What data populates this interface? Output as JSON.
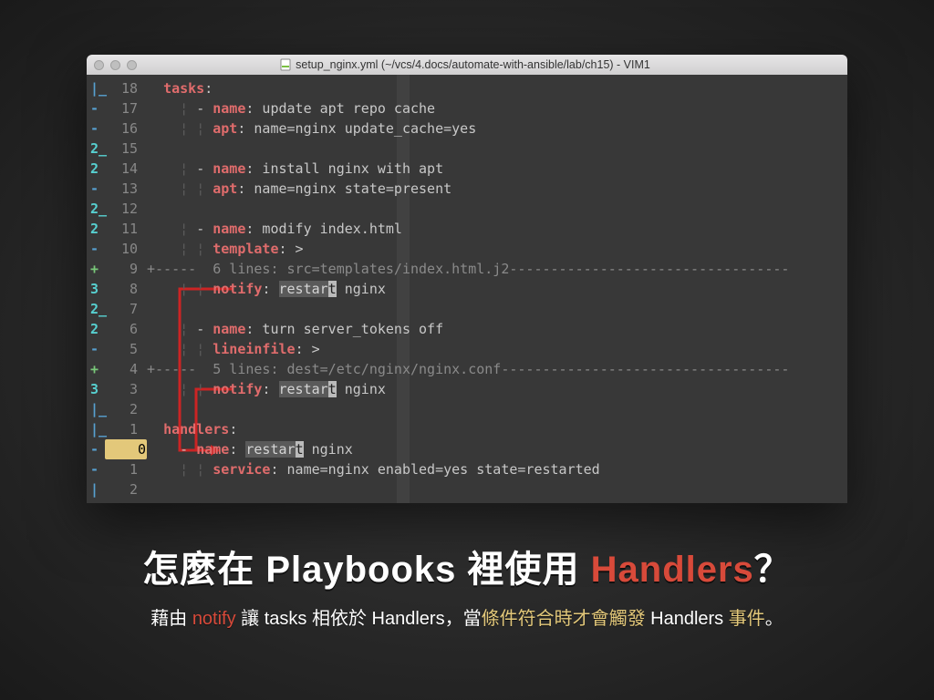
{
  "window_title": "setup_nginx.yml (~/vcs/4.docs/automate-with-ansible/lab/ch15) - VIM1",
  "lines": [
    {
      "sign": "|_",
      "signcls": "s-blue",
      "num": "18",
      "spans": [
        {
          "t": "  ",
          "c": "grey"
        },
        {
          "t": "tasks",
          "c": "kw"
        },
        {
          "t": ":",
          "c": "grey"
        }
      ]
    },
    {
      "sign": "-",
      "signcls": "s-blue",
      "num": "17",
      "spans": [
        {
          "t": "    ",
          "c": "grey"
        },
        {
          "t": "¦ ",
          "c": "guide"
        },
        {
          "t": "- ",
          "c": "grey"
        },
        {
          "t": "name",
          "c": "kw"
        },
        {
          "t": ": update apt repo cache",
          "c": "grey"
        }
      ]
    },
    {
      "sign": "-",
      "signcls": "s-blue",
      "num": "16",
      "spans": [
        {
          "t": "    ",
          "c": "grey"
        },
        {
          "t": "¦ ",
          "c": "guide"
        },
        {
          "t": "¦ ",
          "c": "guide"
        },
        {
          "t": "apt",
          "c": "kw"
        },
        {
          "t": ": name=nginx update_cache=yes",
          "c": "grey"
        }
      ]
    },
    {
      "sign": "2_",
      "signcls": "s-aqua",
      "num": "15",
      "spans": [
        {
          "t": "",
          "c": "grey"
        }
      ]
    },
    {
      "sign": "2",
      "signcls": "s-aqua",
      "num": "14",
      "spans": [
        {
          "t": "    ",
          "c": "grey"
        },
        {
          "t": "¦ ",
          "c": "guide"
        },
        {
          "t": "- ",
          "c": "grey"
        },
        {
          "t": "name",
          "c": "kw"
        },
        {
          "t": ": install nginx with apt",
          "c": "grey"
        }
      ]
    },
    {
      "sign": "-",
      "signcls": "s-blue",
      "num": "13",
      "spans": [
        {
          "t": "    ",
          "c": "grey"
        },
        {
          "t": "¦ ",
          "c": "guide"
        },
        {
          "t": "¦ ",
          "c": "guide"
        },
        {
          "t": "apt",
          "c": "kw"
        },
        {
          "t": ": name=nginx state=present",
          "c": "grey"
        }
      ]
    },
    {
      "sign": "2_",
      "signcls": "s-aqua",
      "num": "12",
      "spans": [
        {
          "t": "",
          "c": "grey"
        }
      ]
    },
    {
      "sign": "2",
      "signcls": "s-aqua",
      "num": "11",
      "spans": [
        {
          "t": "    ",
          "c": "grey"
        },
        {
          "t": "¦ ",
          "c": "guide"
        },
        {
          "t": "- ",
          "c": "grey"
        },
        {
          "t": "name",
          "c": "kw"
        },
        {
          "t": ": modify index.html",
          "c": "grey"
        }
      ]
    },
    {
      "sign": "-",
      "signcls": "s-blue",
      "num": "10",
      "spans": [
        {
          "t": "    ",
          "c": "grey"
        },
        {
          "t": "¦ ",
          "c": "guide"
        },
        {
          "t": "¦ ",
          "c": "guide"
        },
        {
          "t": "template",
          "c": "kw"
        },
        {
          "t": ": >",
          "c": "grey"
        }
      ]
    },
    {
      "sign": "+",
      "signcls": "s-grn",
      "num": "9",
      "spans": [
        {
          "t": "+----- ",
          "c": "fold"
        },
        {
          "t": " 6 lines: src=templates/index.html.j2",
          "c": "dim"
        },
        {
          "t": "----------------------------------",
          "c": "fold"
        }
      ]
    },
    {
      "sign": "3",
      "signcls": "s-aqua",
      "num": "8",
      "spans": [
        {
          "t": "    ",
          "c": "grey"
        },
        {
          "t": "¦ ",
          "c": "guide"
        },
        {
          "t": "¦ ",
          "c": "guide"
        },
        {
          "t": "notify",
          "c": "kw"
        },
        {
          "t": ": ",
          "c": "grey"
        },
        {
          "t": "restar",
          "c": "hl"
        },
        {
          "t": "t",
          "c": "hlc"
        },
        {
          "t": " nginx",
          "c": "grey"
        }
      ]
    },
    {
      "sign": "2_",
      "signcls": "s-aqua",
      "num": "7",
      "spans": [
        {
          "t": "",
          "c": "grey"
        }
      ]
    },
    {
      "sign": "2",
      "signcls": "s-aqua",
      "num": "6",
      "spans": [
        {
          "t": "    ",
          "c": "grey"
        },
        {
          "t": "¦ ",
          "c": "guide"
        },
        {
          "t": "- ",
          "c": "grey"
        },
        {
          "t": "name",
          "c": "kw"
        },
        {
          "t": ": turn server_tokens off",
          "c": "grey"
        }
      ]
    },
    {
      "sign": "-",
      "signcls": "s-blue",
      "num": "5",
      "spans": [
        {
          "t": "    ",
          "c": "grey"
        },
        {
          "t": "¦ ",
          "c": "guide"
        },
        {
          "t": "¦ ",
          "c": "guide"
        },
        {
          "t": "lineinfile",
          "c": "kw"
        },
        {
          "t": ": >",
          "c": "grey"
        }
      ]
    },
    {
      "sign": "+",
      "signcls": "s-grn",
      "num": "4",
      "spans": [
        {
          "t": "+----- ",
          "c": "fold"
        },
        {
          "t": " 5 lines: dest=/etc/nginx/nginx.conf",
          "c": "dim"
        },
        {
          "t": "-----------------------------------",
          "c": "fold"
        }
      ]
    },
    {
      "sign": "3",
      "signcls": "s-aqua",
      "num": "3",
      "spans": [
        {
          "t": "    ",
          "c": "grey"
        },
        {
          "t": "¦ ",
          "c": "guide"
        },
        {
          "t": "¦ ",
          "c": "guide"
        },
        {
          "t": "notify",
          "c": "kw"
        },
        {
          "t": ": ",
          "c": "grey"
        },
        {
          "t": "restar",
          "c": "hl"
        },
        {
          "t": "t",
          "c": "hlc"
        },
        {
          "t": " nginx",
          "c": "grey"
        }
      ]
    },
    {
      "sign": "|_",
      "signcls": "s-blue",
      "num": "2",
      "spans": [
        {
          "t": "",
          "c": "grey"
        }
      ]
    },
    {
      "sign": "|_",
      "signcls": "s-blue",
      "num": "1",
      "spans": [
        {
          "t": "  ",
          "c": "grey"
        },
        {
          "t": "handlers",
          "c": "kw"
        },
        {
          "t": ":",
          "c": "grey"
        }
      ]
    },
    {
      "sign": "-",
      "signcls": "s-blue",
      "num": "0",
      "numcls": "yel0",
      "spans": [
        {
          "t": "    ",
          "c": "grey"
        },
        {
          "t": "- ",
          "c": "grey"
        },
        {
          "t": "name",
          "c": "kw"
        },
        {
          "t": ": ",
          "c": "grey"
        },
        {
          "t": "restar",
          "c": "hl"
        },
        {
          "t": "t",
          "c": "hlc"
        },
        {
          "t": " nginx",
          "c": "grey"
        }
      ]
    },
    {
      "sign": "-",
      "signcls": "s-blue",
      "num": "1",
      "spans": [
        {
          "t": "    ",
          "c": "grey"
        },
        {
          "t": "¦ ",
          "c": "guide"
        },
        {
          "t": "¦ ",
          "c": "guide"
        },
        {
          "t": "service",
          "c": "kw"
        },
        {
          "t": ": name=nginx enabled=yes state=restarted",
          "c": "grey"
        }
      ]
    },
    {
      "sign": "|",
      "signcls": "s-blue",
      "num": "2",
      "spans": [
        {
          "t": "",
          "c": "grey"
        }
      ]
    }
  ],
  "heading": {
    "pre": "怎麼在 Playbooks 裡使用 ",
    "hl": "Handlers",
    "post": "？"
  },
  "sub": {
    "p1": "藉由 ",
    "notify": "notify",
    "p2": " 讓 tasks 相依於 Handlers，當",
    "cond": "條件符合時才會觸發",
    "p3": " Handlers ",
    "evt": "事件",
    "p4": "。"
  }
}
